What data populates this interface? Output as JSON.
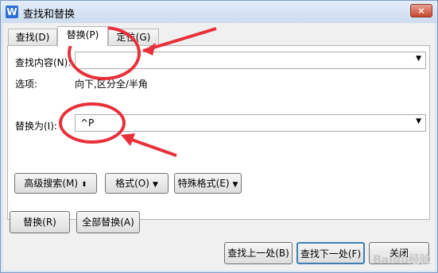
{
  "window": {
    "title": "查找和替换",
    "app_icon": "W",
    "close_label": "✕"
  },
  "tabs": [
    {
      "label": "查找(D)",
      "active": false
    },
    {
      "label": "替换(P)",
      "active": true
    },
    {
      "label": "定位(G)",
      "active": false
    }
  ],
  "find": {
    "label": "查找内容(N):",
    "value": ""
  },
  "options": {
    "label": "选项:",
    "value": "向下,区分全/半角"
  },
  "replace": {
    "label": "替换为(I):",
    "value": "^P"
  },
  "panel_buttons": {
    "advanced_search": "高级搜索(M)",
    "format": "格式(O)",
    "special_format": "特殊格式(E)"
  },
  "actions": {
    "replace": "替换(R)",
    "replace_all": "全部替换(A)",
    "find_prev": "查找上一处(B)",
    "find_next": "查找下一处(F)",
    "close": "关闭"
  },
  "annotation_color": "#e8303a",
  "watermark": "Baidu经验"
}
